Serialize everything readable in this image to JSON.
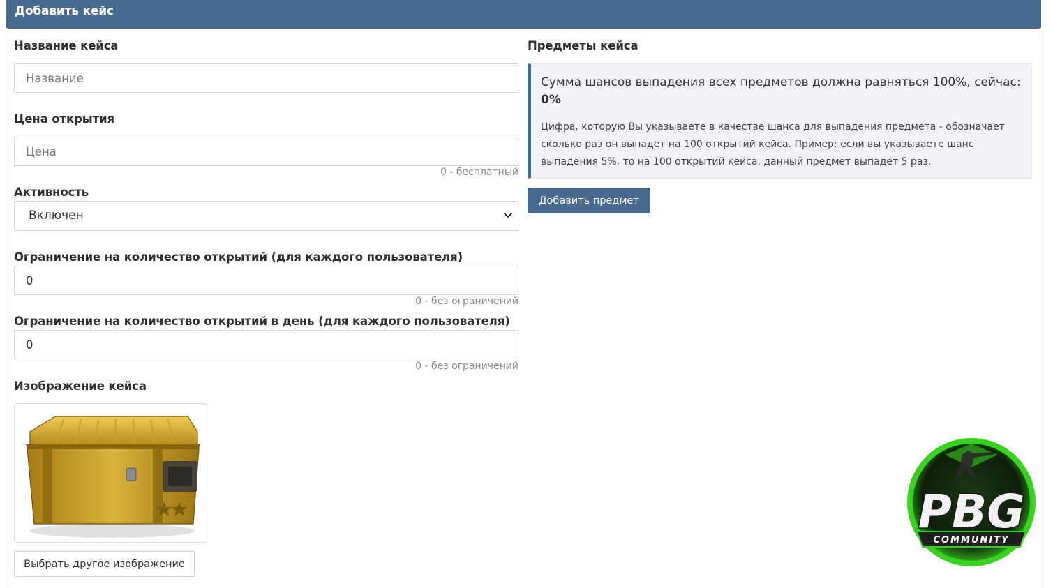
{
  "header": {
    "title": "Добавить кейс"
  },
  "form": {
    "name_label": "Название кейса",
    "name_placeholder": "Название",
    "price_label": "Цена открытия",
    "price_placeholder": "Цена",
    "price_hint": "0 - бесплатный",
    "activity_label": "Активность",
    "activity_value": "Включен",
    "limit_label": "Ограничение на количество открытий (для каждого пользователя)",
    "limit_value": "0",
    "limit_hint": "0 - без ограничений",
    "daily_limit_label": "Ограничение на количество открытий в день (для каждого пользователя)",
    "daily_limit_value": "0",
    "daily_limit_hint": "0 - без ограничений",
    "image_label": "Изображение кейса",
    "change_image_button": "Выбрать другое изображение"
  },
  "items": {
    "title": "Предметы кейса",
    "alert_title": "Сумма шансов выпадения всех предметов должна равняться 100%, сейчас:",
    "alert_value": "0%",
    "alert_text": "Цифра, которую Вы указываете в качестве шанса для выпадения предмета - обозначает сколько раз он выпадет на 100 открытий кейса. Пример: если вы указываете шанс выпадения 5%, то на 100 открытий кейса, данный предмет выпадет 5 раз.",
    "add_button": "Добавить предмет"
  },
  "logo": {
    "main": "PBG",
    "sub": "COMMUNITY"
  },
  "colors": {
    "header": "#486a8e",
    "accent": "#486a8e",
    "logo_green": "#39d11f"
  }
}
